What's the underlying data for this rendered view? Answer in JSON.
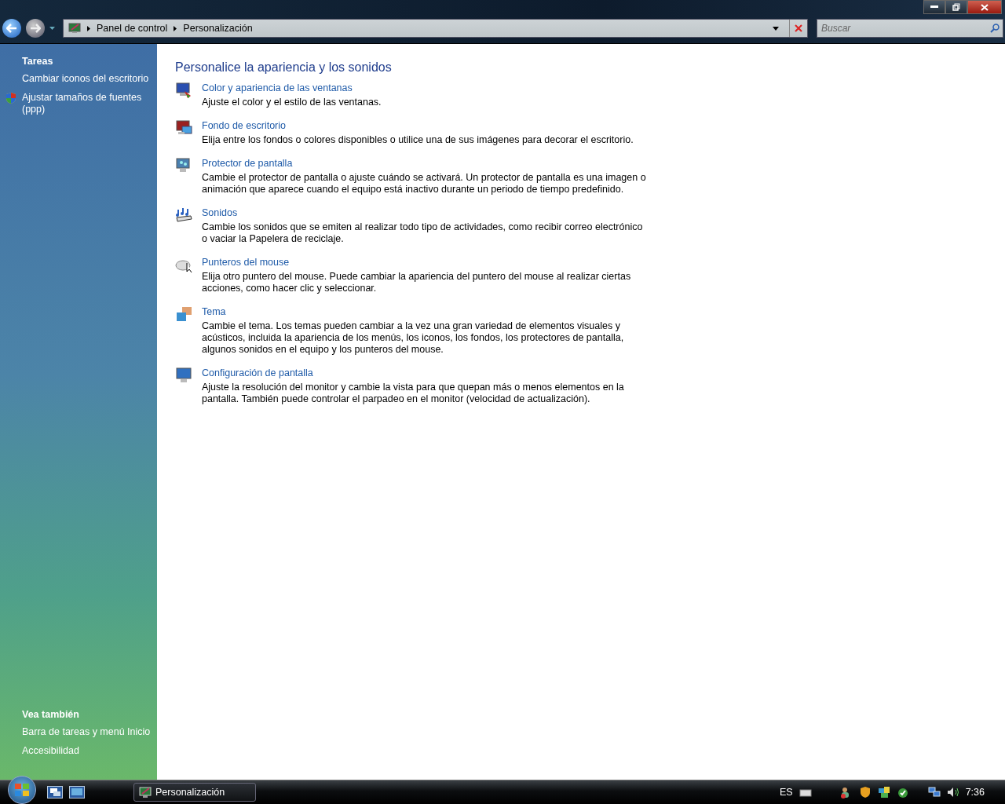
{
  "window": {
    "breadcrumb": [
      "Panel de control",
      "Personalización"
    ],
    "search": {
      "placeholder": "Buscar"
    }
  },
  "sidebar": {
    "tasks_title": "Tareas",
    "tasks": [
      {
        "label": "Cambiar iconos del escritorio",
        "shield": false
      },
      {
        "label": "Ajustar tamaños de fuentes (ppp)",
        "shield": true
      }
    ],
    "see_also_title": "Vea también",
    "see_also": [
      "Barra de tareas y menú Inicio",
      "Accesibilidad"
    ]
  },
  "main": {
    "heading": "Personalice la apariencia y los sonidos",
    "items": [
      {
        "kind": "color",
        "title": "Color y apariencia de las ventanas",
        "description": "Ajuste el color y el estilo de las ventanas."
      },
      {
        "kind": "background",
        "title": "Fondo de escritorio",
        "description": "Elija entre los fondos o colores disponibles o utilice una de sus imágenes para decorar el escritorio."
      },
      {
        "kind": "screensaver",
        "title": "Protector de pantalla",
        "description": "Cambie el protector de pantalla o ajuste cuándo se activará. Un protector de pantalla es una imagen o animación que aparece cuando el equipo está inactivo durante un periodo de tiempo predefinido."
      },
      {
        "kind": "sounds",
        "title": "Sonidos",
        "description": "Cambie los sonidos que se emiten al realizar todo tipo de actividades, como recibir correo electrónico o vaciar la Papelera de reciclaje."
      },
      {
        "kind": "mouse",
        "title": "Punteros del mouse",
        "description": "Elija otro puntero del mouse. Puede cambiar la apariencia del puntero del mouse al realizar ciertas acciones, como hacer clic y seleccionar."
      },
      {
        "kind": "theme",
        "title": "Tema",
        "description": "Cambie el tema. Los temas pueden cambiar a la vez una gran variedad de elementos visuales y acústicos, incluida la apariencia de los menús, los iconos, los fondos, los protectores de pantalla, algunos sonidos en el equipo y los punteros del mouse."
      },
      {
        "kind": "display",
        "title": "Configuración de pantalla",
        "description": "Ajuste la resolución del monitor y cambie la vista para que quepan más o menos elementos en la pantalla. También puede controlar el parpadeo en el monitor (velocidad de actualización)."
      }
    ]
  },
  "taskbar": {
    "windows": [
      "Personalización"
    ],
    "language": "ES",
    "clock": "7:36"
  }
}
